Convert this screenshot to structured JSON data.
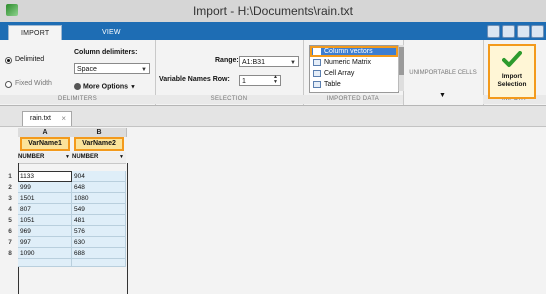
{
  "window": {
    "title": "Import - H:\\Documents\\rain.txt"
  },
  "tabs": [
    {
      "label": "IMPORT",
      "active": true
    },
    {
      "label": "VIEW",
      "active": false
    }
  ],
  "delimiters": {
    "options": [
      {
        "label": "Delimited",
        "selected": true
      },
      {
        "label": "Fixed Width",
        "selected": false
      }
    ],
    "column_delimiters_label": "Column delimiters:",
    "column_delimiters_value": "Space",
    "more_options_label": "More Options",
    "group_label": "DELIMITERS"
  },
  "selection": {
    "range_label": "Range:",
    "range_value": "A1:B31",
    "var_names_row_label": "Variable Names Row:",
    "var_names_row_value": "1",
    "group_label": "SELECTION"
  },
  "imported_data": {
    "items": [
      {
        "label": "Column vectors",
        "icon": "column-vectors-icon",
        "selected": true
      },
      {
        "label": "Numeric Matrix",
        "icon": "numeric-matrix-icon",
        "selected": false
      },
      {
        "label": "Cell Array",
        "icon": "cell-array-icon",
        "selected": false
      },
      {
        "label": "Table",
        "icon": "table-icon",
        "selected": false
      }
    ],
    "group_label": "IMPORTED DATA"
  },
  "unimportable": {
    "label": "UNIMPORTABLE CELLS"
  },
  "import_group": {
    "button_label": "Import Selection",
    "group_label": "IMPORT"
  },
  "document_tab": {
    "label": "rain.txt"
  },
  "grid": {
    "columns": [
      {
        "letter": "A",
        "var_name": "VarName1",
        "type": "NUMBER"
      },
      {
        "letter": "B",
        "var_name": "VarName2",
        "type": "NUMBER"
      }
    ],
    "rows": [
      {
        "num": "1",
        "values": [
          "1133",
          "904"
        ]
      },
      {
        "num": "2",
        "values": [
          "999",
          "648"
        ]
      },
      {
        "num": "3",
        "values": [
          "1501",
          "1080"
        ]
      },
      {
        "num": "4",
        "values": [
          "807",
          "549"
        ]
      },
      {
        "num": "5",
        "values": [
          "1051",
          "481"
        ]
      },
      {
        "num": "6",
        "values": [
          "969",
          "576"
        ]
      },
      {
        "num": "7",
        "values": [
          "997",
          "630"
        ]
      },
      {
        "num": "8",
        "values": [
          "1090",
          "688"
        ]
      }
    ]
  },
  "colors": {
    "accent_blue": "#1e6db4",
    "highlight_orange": "#f39a1c",
    "cell_bg": "#dfeef8"
  }
}
